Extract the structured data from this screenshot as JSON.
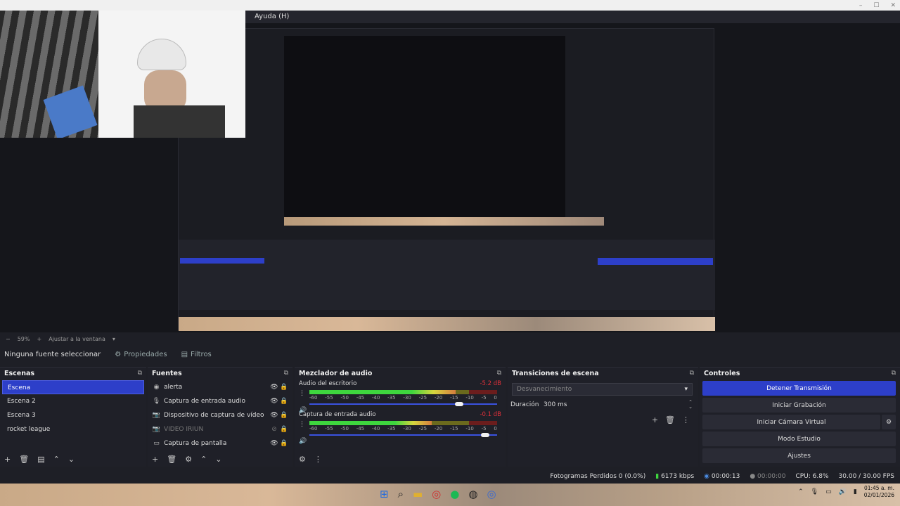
{
  "menubar": {
    "help": "Ayuda (H)"
  },
  "preview": {
    "zoom": "59%",
    "fit_label": "Ajustar a la ventana"
  },
  "source_bar": {
    "no_source": "Ninguna fuente seleccionar",
    "properties": "Propiedades",
    "filters": "Filtros"
  },
  "scenes": {
    "title": "Escenas",
    "items": [
      "Escena",
      "Escena 2",
      "Escena 3",
      "rocket league"
    ],
    "selected": 0
  },
  "sources": {
    "title": "Fuentes",
    "items": [
      {
        "label": "alerta",
        "icon": "globe-icon",
        "visible": true
      },
      {
        "label": "Captura de entrada audio",
        "icon": "microphone-icon",
        "visible": true
      },
      {
        "label": "Dispositivo de captura de vídeo",
        "icon": "camera-icon",
        "visible": true
      },
      {
        "label": "VIDEO IRIUN",
        "icon": "camera-icon",
        "visible": false
      },
      {
        "label": "Captura de pantalla",
        "icon": "monitor-icon",
        "visible": true
      }
    ]
  },
  "mixer": {
    "title": "Mezclador de audio",
    "ticks": [
      "-60",
      "-55",
      "-50",
      "-45",
      "-40",
      "-35",
      "-30",
      "-25",
      "-20",
      "-15",
      "-10",
      "-5",
      "0"
    ],
    "channels": [
      {
        "name": "Audio del escritorio",
        "db": "-5.2 dB",
        "level": 0.78,
        "fader": 0.82
      },
      {
        "name": "Captura de entrada audio",
        "db": "-0.1 dB",
        "level": 0.65,
        "fader": 0.96
      }
    ]
  },
  "transitions": {
    "title": "Transiciones de escena",
    "selected": "Desvanecimiento",
    "duration_label": "Duración",
    "duration_value": "300 ms"
  },
  "controls": {
    "title": "Controles",
    "stop_stream": "Detener Transmisión",
    "start_record": "Iniciar Grabación",
    "start_virtualcam": "Iniciar Cámara Virtual",
    "studio_mode": "Modo Estudio",
    "settings": "Ajustes"
  },
  "status": {
    "dropped_frames": "Fotogramas Perdidos 0 (0.0%)",
    "bitrate": "6173 kbps",
    "stream_time": "00:00:13",
    "record_time": "00:00:00",
    "cpu": "CPU: 6.8%",
    "fps": "30.00 / 30.00 FPS"
  },
  "taskbar": {
    "time": "01:45 a. m.",
    "date": "02/01/2026"
  },
  "colors": {
    "accent": "#2d3fc9",
    "background": "#1e1f26",
    "panel": "#1f2028"
  }
}
